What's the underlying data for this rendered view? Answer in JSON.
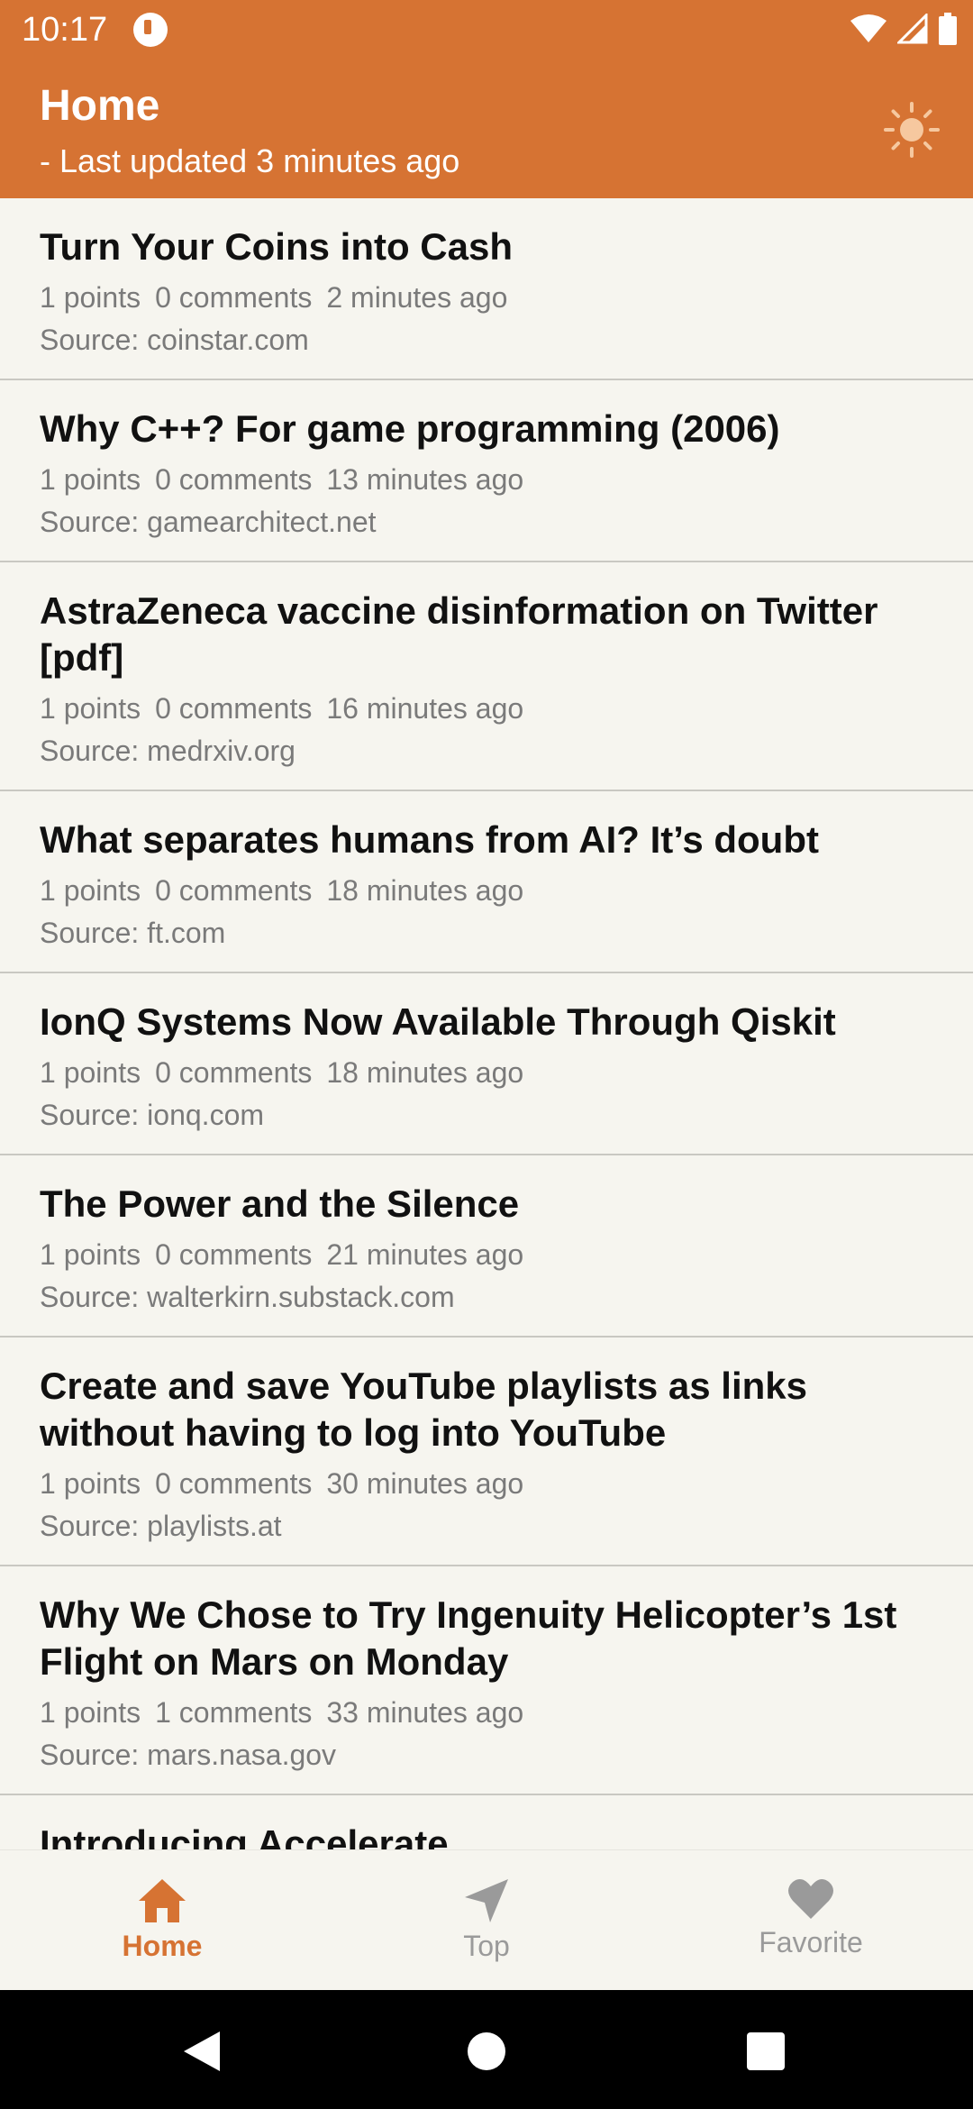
{
  "status_bar": {
    "time": "10:17",
    "icons": [
      "app-notification-icon",
      "wifi-icon",
      "signal-icon",
      "battery-icon"
    ]
  },
  "app_bar": {
    "title": "Home",
    "subtitle": "- Last updated 3 minutes ago",
    "theme_icon": "sun-icon"
  },
  "stories": [
    {
      "title": "Turn Your Coins into Cash",
      "points": "1 points",
      "comments": "0 comments",
      "time": "2 minutes ago",
      "source": "Source: coinstar.com"
    },
    {
      "title": "Why C++? For game programming (2006)",
      "points": "1 points",
      "comments": "0 comments",
      "time": "13 minutes ago",
      "source": "Source: gamearchitect.net"
    },
    {
      "title": "AstraZeneca vaccine disinformation on Twitter [pdf]",
      "points": "1 points",
      "comments": "0 comments",
      "time": "16 minutes ago",
      "source": "Source: medrxiv.org"
    },
    {
      "title": "What separates humans from AI? It’s doubt",
      "points": "1 points",
      "comments": "0 comments",
      "time": "18 minutes ago",
      "source": "Source: ft.com"
    },
    {
      "title": "IonQ Systems Now Available Through Qiskit",
      "points": "1 points",
      "comments": "0 comments",
      "time": "18 minutes ago",
      "source": "Source: ionq.com"
    },
    {
      "title": "The Power and the Silence",
      "points": "1 points",
      "comments": "0 comments",
      "time": "21 minutes ago",
      "source": "Source: walterkirn.substack.com"
    },
    {
      "title": "Create and save YouTube playlists as links without having to log into YouTube",
      "points": "1 points",
      "comments": "0 comments",
      "time": "30 minutes ago",
      "source": "Source: playlists.at"
    },
    {
      "title": "Why We Chose to Try Ingenuity Helicopter’s 1st Flight on Mars on Monday",
      "points": "1 points",
      "comments": "1 comments",
      "time": "33 minutes ago",
      "source": "Source: mars.nasa.gov"
    },
    {
      "title": "Introducing Accelerate",
      "points": "",
      "comments": "",
      "time": "",
      "source": ""
    }
  ],
  "bottom_nav": {
    "items": [
      {
        "label": "Home",
        "icon": "home-icon",
        "active": true
      },
      {
        "label": "Top",
        "icon": "navigation-arrow-icon",
        "active": false
      },
      {
        "label": "Favorite",
        "icon": "heart-icon",
        "active": false
      }
    ]
  },
  "colors": {
    "accent": "#d67333",
    "background": "#f6f5ef",
    "secondary_text": "#7a7a7a",
    "inactive_nav": "#9a9a9a"
  }
}
